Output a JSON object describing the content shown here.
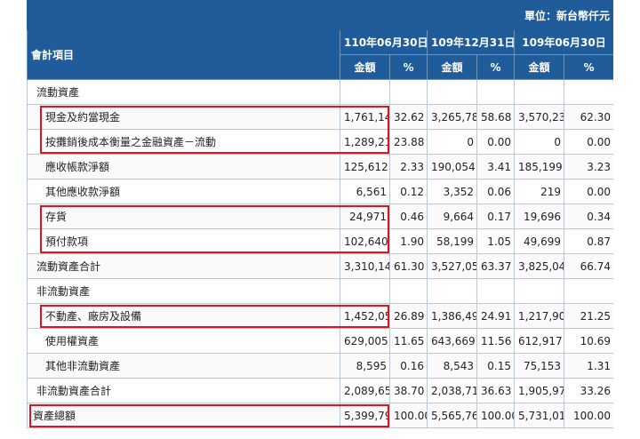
{
  "unit_label": "單位：新台幣仟元",
  "header": {
    "item_label": "會計項目",
    "periods": [
      "110年06月30日",
      "109年12月31日",
      "109年06月30日"
    ],
    "amount_label": "金額",
    "pct_label": "%"
  },
  "rows": [
    {
      "label": "流動資產",
      "level": 1,
      "vals": [
        "",
        "",
        "",
        "",
        "",
        ""
      ]
    },
    {
      "label": "現金及約當現金",
      "level": 2,
      "vals": [
        "1,761,148",
        "32.62",
        "3,265,785",
        "58.68",
        "3,570,235",
        "62.30"
      ],
      "highlight": true
    },
    {
      "label": "按攤銷後成本衡量之金融資產－流動",
      "level": 2,
      "vals": [
        "1,289,214",
        "23.88",
        "0",
        "0.00",
        "0",
        "0.00"
      ],
      "highlight": true
    },
    {
      "label": "應收帳款淨額",
      "level": 2,
      "vals": [
        "125,612",
        "2.33",
        "190,054",
        "3.41",
        "185,199",
        "3.23"
      ]
    },
    {
      "label": "其他應收款淨額",
      "level": 2,
      "vals": [
        "6,561",
        "0.12",
        "3,352",
        "0.06",
        "219",
        "0.00"
      ]
    },
    {
      "label": "存貨",
      "level": 2,
      "vals": [
        "24,971",
        "0.46",
        "9,664",
        "0.17",
        "19,696",
        "0.34"
      ],
      "highlight": true
    },
    {
      "label": "預付款項",
      "level": 2,
      "vals": [
        "102,640",
        "1.90",
        "58,199",
        "1.05",
        "49,699",
        "0.87"
      ],
      "highlight": true
    },
    {
      "label": "流動資產合計",
      "level": 1,
      "vals": [
        "3,310,146",
        "61.30",
        "3,527,054",
        "63.37",
        "3,825,048",
        "66.74"
      ]
    },
    {
      "label": "非流動資產",
      "level": 1,
      "vals": [
        "",
        "",
        "",
        "",
        "",
        ""
      ]
    },
    {
      "label": "不動產、廠房及設備",
      "level": 2,
      "vals": [
        "1,452,052",
        "26.89",
        "1,386,499",
        "24.91",
        "1,217,901",
        "21.25"
      ],
      "highlight": true
    },
    {
      "label": "使用權資產",
      "level": 2,
      "vals": [
        "629,005",
        "11.65",
        "643,669",
        "11.56",
        "612,917",
        "10.69"
      ]
    },
    {
      "label": "其他非流動資產",
      "level": 2,
      "vals": [
        "8,595",
        "0.16",
        "8,543",
        "0.15",
        "75,153",
        "1.31"
      ]
    },
    {
      "label": "非流動資產合計",
      "level": 1,
      "vals": [
        "2,089,652",
        "38.70",
        "2,038,711",
        "36.63",
        "1,905,971",
        "33.26"
      ]
    },
    {
      "label": "資產總額",
      "level": 0,
      "vals": [
        "5,399,798",
        "100.00",
        "5,565,765",
        "100.00",
        "5,731,019",
        "100.00"
      ],
      "highlight": true
    }
  ],
  "colors": {
    "header_bg": "#1f5c99",
    "highlight_border": "#e0141e"
  }
}
